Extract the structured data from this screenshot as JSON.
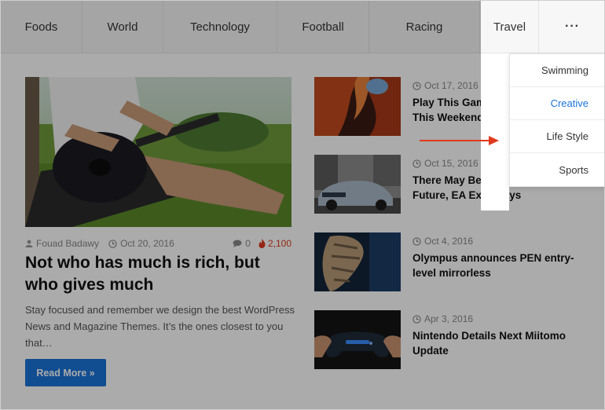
{
  "nav": {
    "items": [
      {
        "label": "Foods"
      },
      {
        "label": "World"
      },
      {
        "label": "Technology"
      },
      {
        "label": "Football"
      },
      {
        "label": "Racing"
      },
      {
        "label": "Travel"
      }
    ],
    "more_label": "···"
  },
  "dropdown": {
    "items": [
      {
        "label": "Swimming"
      },
      {
        "label": "Creative"
      },
      {
        "label": "Life Style"
      },
      {
        "label": "Sports"
      }
    ]
  },
  "feature": {
    "author": "Fouad Badawy",
    "date": "Oct 20, 2016",
    "comments": "0",
    "views": "2,100",
    "title": "Not who has much is rich, but who gives much",
    "excerpt": "Stay focused and remember we design the best WordPress News and Magazine Themes. It’s the ones closest to you that…",
    "read_more": "Read More »"
  },
  "posts": [
    {
      "date": "Oct 17, 2016",
      "title": "Play This Game for Free on Steam This Weekend"
    },
    {
      "date": "Oct 15, 2016",
      "title": "There May Be No Consoles in the Future, EA Exec Says"
    },
    {
      "date": "Oct 4, 2016",
      "title": "Olympus announces PEN entry-level mirrorless"
    },
    {
      "date": "Apr 3, 2016",
      "title": "Nintendo Details Next Miitomo Update"
    }
  ],
  "colors": {
    "accent": "#1a73d8",
    "views": "#e03a1e",
    "arrow": "#e03a1e"
  }
}
